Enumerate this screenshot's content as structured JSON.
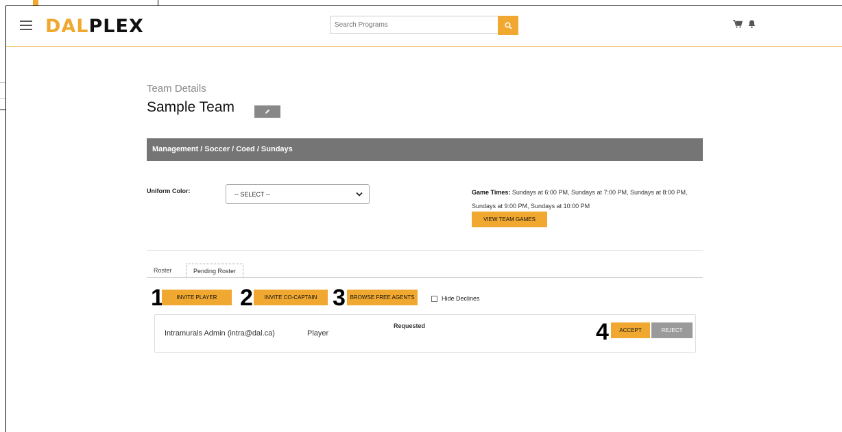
{
  "header": {
    "logo_part1": "DAL",
    "logo_part2": "PLEX",
    "search_placeholder": "Search Programs"
  },
  "page": {
    "label": "Team Details",
    "team_name": "Sample Team",
    "breadcrumb": "Management / Soccer / Coed / Sundays"
  },
  "uniform": {
    "label": "Uniform Color:",
    "selected": "-- SELECT --"
  },
  "game_times": {
    "label": "Game Times:",
    "value": "Sundays at 6:00 PM, Sundays at 7:00 PM, Sundays at 8:00 PM, Sundays at 9:00 PM, Sundays at 10:00 PM",
    "button": "VIEW TEAM GAMES"
  },
  "tabs": [
    {
      "label": "Roster"
    },
    {
      "label": "Pending Roster"
    }
  ],
  "actions": {
    "invite_player": "INVITE PLAYER",
    "invite_cocaptain": "INVITE CO-CAPTAIN",
    "browse_free_agents": "BROWSE FREE AGENTS",
    "hide_declines": "Hide Declines"
  },
  "annotations": [
    "1",
    "2",
    "3",
    "4"
  ],
  "pending": [
    {
      "name": "Intramurals Admin (intra@dal.ca)",
      "role": "Player",
      "status": "Requested",
      "accept": "ACCEPT",
      "reject": "REJECT"
    }
  ],
  "colors": {
    "accent": "#f0a830",
    "breadcrumb_bg": "#757575"
  }
}
